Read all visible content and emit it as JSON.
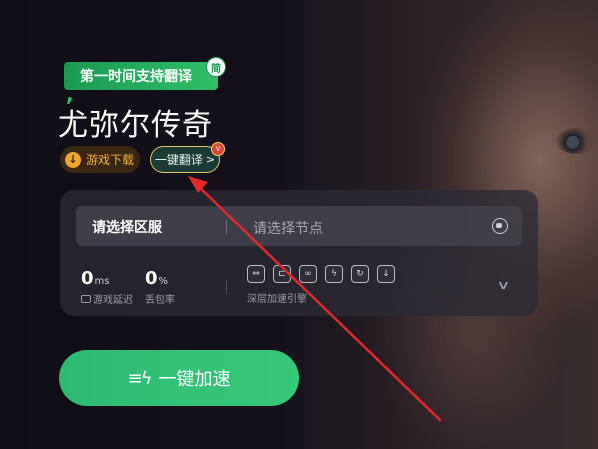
{
  "badge": {
    "text": "第一时间支持翻译",
    "corner": "简"
  },
  "game": {
    "title": "尤弥尔传奇"
  },
  "buttons": {
    "download_label": "游戏下载",
    "translate_label": "一键翻译",
    "translate_chevron": ">",
    "translate_dot": "V",
    "accelerate_label": "一键加速"
  },
  "server": {
    "region_label": "请选择区服",
    "node_placeholder": "请选择节点"
  },
  "stats": {
    "latency_value": "0",
    "latency_unit": "ms",
    "latency_label": "游戏延迟",
    "loss_value": "0",
    "loss_unit": "%",
    "loss_label": "丢包率"
  },
  "engine": {
    "label": "深层加速引擎",
    "icons": [
      "link-icon",
      "route-icon",
      "nodes-icon",
      "lightning-icon",
      "sync-icon",
      "download-icon"
    ]
  },
  "colors": {
    "accent_green": "#2fbf66",
    "annotation_red": "#e02a2a",
    "download_orange": "#f0a22a"
  }
}
